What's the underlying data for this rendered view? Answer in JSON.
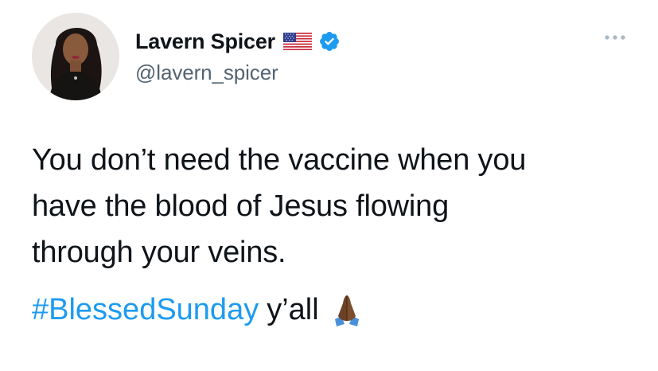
{
  "tweet": {
    "author": {
      "display_name": "Lavern Spicer",
      "handle": "@lavern_spicer",
      "flag_icon": "us-flag-icon",
      "verified_icon": "verified-badge-icon",
      "avatar": "avatar"
    },
    "more_icon": "more-options-icon",
    "text_lines": [
      "You don’t need the vaccine when you",
      "have the blood of Jesus flowing",
      "through your veins."
    ],
    "hashtag": "#BlessedSunday",
    "suffix": "y’all",
    "emoji_icon": "praying-hands-icon"
  },
  "colors": {
    "text": "#0f1419",
    "secondary": "#536471",
    "link": "#1d9bf0",
    "verified": "#1d9bf0"
  }
}
